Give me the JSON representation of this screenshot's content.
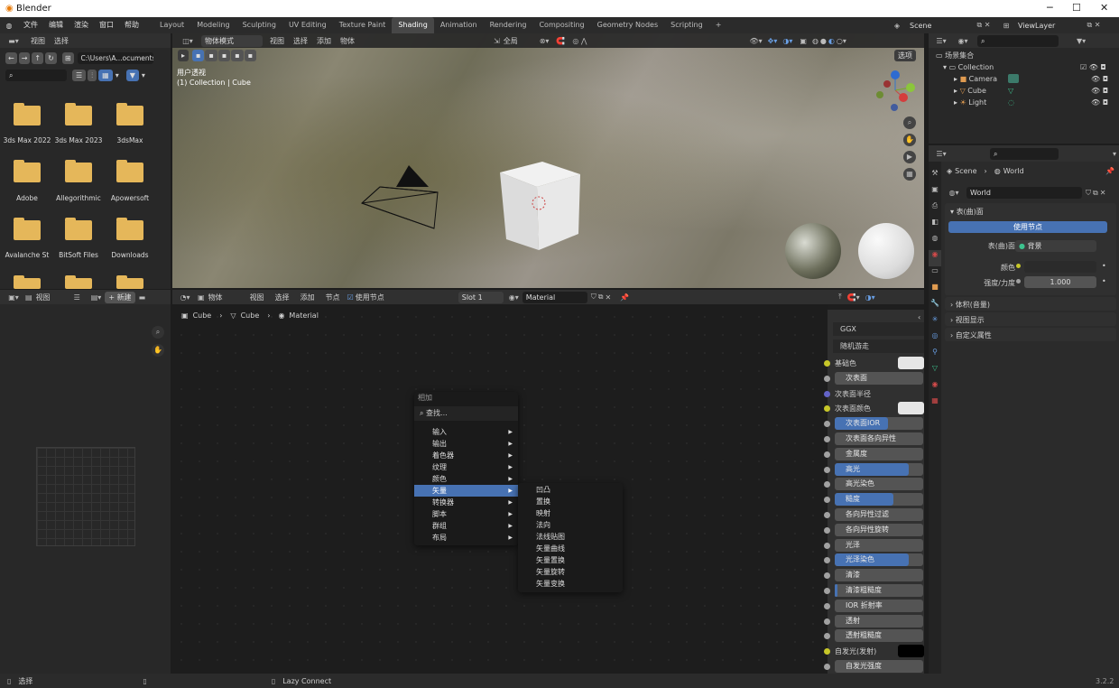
{
  "titlebar": {
    "app": "Blender",
    "min": "─",
    "max": "☐",
    "close": "✕"
  },
  "menubar": {
    "menus": [
      "文件",
      "编辑",
      "渲染",
      "窗口",
      "帮助"
    ],
    "workspaces": [
      "Layout",
      "Modeling",
      "Sculpting",
      "UV Editing",
      "Texture Paint",
      "Shading",
      "Animation",
      "Rendering",
      "Compositing",
      "Geometry Nodes",
      "Scripting"
    ],
    "add_tab": "+",
    "scene": "Scene",
    "viewlayer": "ViewLayer"
  },
  "filebrowser": {
    "menus": [
      "视图",
      "选择"
    ],
    "path": "C:\\Users\\A...ocuments\\",
    "folders": [
      "3ds Max 2022",
      "3ds Max 2023",
      "3dsMax",
      "Adobe",
      "Allegorithmic",
      "Apowersoft",
      "Avalanche St",
      "BitSoft Files",
      "Downloads"
    ]
  },
  "viewport": {
    "mode": "物体模式",
    "menus": [
      "视图",
      "选择",
      "添加",
      "物体"
    ],
    "transform": "全局",
    "overlay_label": "选项",
    "view_name": "用户透视",
    "collection_path": "(1) Collection | Cube"
  },
  "imageeditor": {
    "menus": [
      "视图"
    ],
    "new": "新建"
  },
  "nodeeditor": {
    "type": "物体",
    "menus": [
      "视图",
      "选择",
      "添加",
      "节点"
    ],
    "use_nodes": "使用节点",
    "slot": "Slot 1",
    "material": "Material",
    "breadcrumb": [
      "Cube",
      "Cube",
      "Material"
    ]
  },
  "add_menu": {
    "title": "相加",
    "search": "查找...",
    "items": [
      "输入",
      "输出",
      "着色器",
      "纹理",
      "颜色",
      "矢量",
      "转换器",
      "脚本",
      "群组",
      "布局"
    ],
    "highlight_index": 5,
    "submenu": [
      "凹凸",
      "置换",
      "映射",
      "法向",
      "法线贴图",
      "矢量曲线",
      "矢量置换",
      "矢量旋转",
      "矢量变换"
    ]
  },
  "bsdf": {
    "dist": "GGX",
    "ss": "随机游走",
    "rows": [
      {
        "label": "基础色",
        "type": "color",
        "sock": "#c7c729",
        "swatch": "#e6e6e6"
      },
      {
        "label": "次表面",
        "type": "field",
        "sock": "#a1a1a1",
        "fill": 0.0
      },
      {
        "label": "次表面半径",
        "type": "plain",
        "sock": "#6363c7"
      },
      {
        "label": "次表面颜色",
        "type": "color",
        "sock": "#c7c729",
        "swatch": "#e6e6e6"
      },
      {
        "label": "次表面IOR",
        "type": "field",
        "sock": "#a1a1a1",
        "fill": 0.6
      },
      {
        "label": "次表面各向异性",
        "type": "field",
        "sock": "#a1a1a1",
        "fill": 0.0
      },
      {
        "label": "金属度",
        "type": "field",
        "sock": "#a1a1a1",
        "fill": 0.0
      },
      {
        "label": "高光",
        "type": "field",
        "sock": "#a1a1a1",
        "fill": 0.84
      },
      {
        "label": "高光染色",
        "type": "field",
        "sock": "#a1a1a1",
        "fill": 0.0
      },
      {
        "label": "糙度",
        "type": "field",
        "sock": "#a1a1a1",
        "fill": 0.66
      },
      {
        "label": "各向异性过滤",
        "type": "field",
        "sock": "#a1a1a1",
        "fill": 0.0
      },
      {
        "label": "各向异性旋转",
        "type": "field",
        "sock": "#a1a1a1",
        "fill": 0.0
      },
      {
        "label": "光泽",
        "type": "field",
        "sock": "#a1a1a1",
        "fill": 0.0
      },
      {
        "label": "光泽染色",
        "type": "field",
        "sock": "#a1a1a1",
        "fill": 0.84
      },
      {
        "label": "清漆",
        "type": "field",
        "sock": "#a1a1a1",
        "fill": 0.0
      },
      {
        "label": "清漆粗糙度",
        "type": "field",
        "sock": "#a1a1a1",
        "fill": 0.03
      },
      {
        "label": "IOR 折射率",
        "type": "field",
        "sock": "#a1a1a1",
        "fill": 0.0
      },
      {
        "label": "透射",
        "type": "field",
        "sock": "#a1a1a1",
        "fill": 0.0
      },
      {
        "label": "透射粗糙度",
        "type": "field",
        "sock": "#a1a1a1",
        "fill": 0.0
      },
      {
        "label": "自发光(发射)",
        "type": "color",
        "sock": "#c7c729",
        "swatch": "#000000"
      },
      {
        "label": "自发光强度",
        "type": "field",
        "sock": "#a1a1a1",
        "fill": 0.0
      }
    ]
  },
  "outliner": {
    "root": "场景集合",
    "collection": "Collection",
    "items": [
      "Camera",
      "Cube",
      "Light"
    ]
  },
  "properties": {
    "crumb_scene": "Scene",
    "crumb_world": "World",
    "world_name": "World",
    "surface_panel": "表(曲)面",
    "use_nodes": "使用节点",
    "surface_label": "表(曲)面",
    "surface_value": "背景",
    "color_label": "颜色",
    "strength_label": "强度/力度",
    "strength_value": "1.000",
    "panels": [
      "体积(音量)",
      "视图显示",
      "自定义属性"
    ]
  },
  "statusbar": {
    "select": "选择",
    "lazy": "Lazy Connect",
    "version": "3.2.2"
  }
}
